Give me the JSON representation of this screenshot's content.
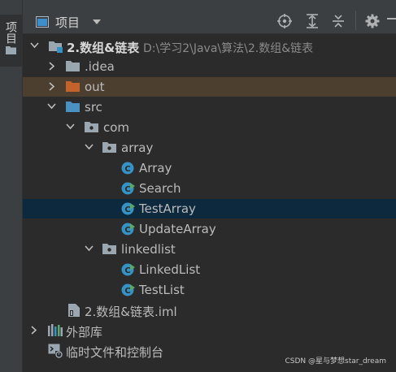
{
  "sidebar": {
    "project_tab_label": "项目"
  },
  "toolbar": {
    "view_label": "项目"
  },
  "tree": {
    "root": {
      "label": "2.数组&链表",
      "path": "D:\\学习2\\Java\\算法\\2.数组&链表"
    },
    "idea": {
      "label": ".idea"
    },
    "out": {
      "label": "out"
    },
    "src": {
      "label": "src"
    },
    "com": {
      "label": "com"
    },
    "array": {
      "label": "array"
    },
    "array_class": {
      "label": "Array"
    },
    "search_class": {
      "label": "Search"
    },
    "testarray_class": {
      "label": "TestArray"
    },
    "updatearray_class": {
      "label": "UpdateArray"
    },
    "linkedlist": {
      "label": "linkedlist"
    },
    "linkedlist_class": {
      "label": "LinkedList"
    },
    "testlist_class": {
      "label": "TestList"
    },
    "iml": {
      "label": "2.数组&链表.iml"
    },
    "external_libs": {
      "label": "外部库"
    },
    "scratches": {
      "label": "临时文件和控制台"
    }
  },
  "watermark": "CSDN @星与梦想star_dream",
  "colors": {
    "background": "#2b2b2b",
    "toolbar": "#3c3f41",
    "selection": "#0d293e",
    "excluded_folder_row": "#4d3f2f",
    "class_icon": "#3592c4",
    "run_badge": "#59a869",
    "excluded_folder_icon": "#c3632b",
    "source_folder_icon": "#4a90c0"
  },
  "icons": {
    "view": "project-view-icon",
    "dropdown": "chevron-down-icon",
    "locate": "crosshair-icon",
    "expand": "expand-all-icon",
    "collapse": "collapse-all-icon",
    "settings": "gear-icon"
  }
}
